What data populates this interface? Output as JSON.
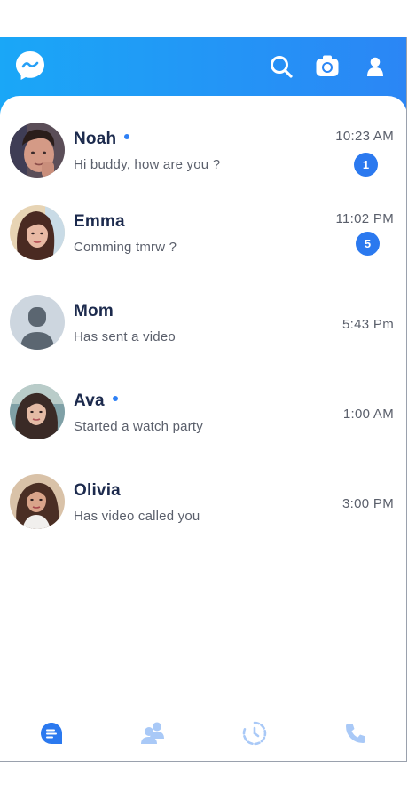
{
  "colors": {
    "header_start": "#1aa7f7",
    "header_end": "#2b86f5",
    "accent": "#2b79ef",
    "name_text": "#1c2a4d",
    "secondary_text": "#5a5f6b",
    "nav_inactive": "#a9c9f7"
  },
  "header": {
    "icons": [
      "messenger-logo-icon",
      "search-icon",
      "camera-icon",
      "profile-icon"
    ]
  },
  "chats": [
    {
      "name": "Noah",
      "message": "Hi buddy, how are you ?",
      "time": "10:23 AM",
      "unread": "1",
      "online": true
    },
    {
      "name": "Emma",
      "message": "Comming tmrw ?",
      "time": "11:02 PM",
      "unread": "5",
      "online": false
    },
    {
      "name": "Mom",
      "message": "Has sent a video",
      "time": "5:43 Pm",
      "unread": null,
      "online": false
    },
    {
      "name": "Ava",
      "message": "Started a watch party",
      "time": "1:00 AM",
      "unread": null,
      "online": true
    },
    {
      "name": "Olivia",
      "message": "Has video called you",
      "time": "3:00 PM",
      "unread": null,
      "online": false
    }
  ],
  "bottom_nav": {
    "items": [
      {
        "icon": "chats-icon",
        "active": true
      },
      {
        "icon": "people-icon",
        "active": false
      },
      {
        "icon": "stories-icon",
        "active": false
      },
      {
        "icon": "calls-icon",
        "active": false
      }
    ]
  }
}
